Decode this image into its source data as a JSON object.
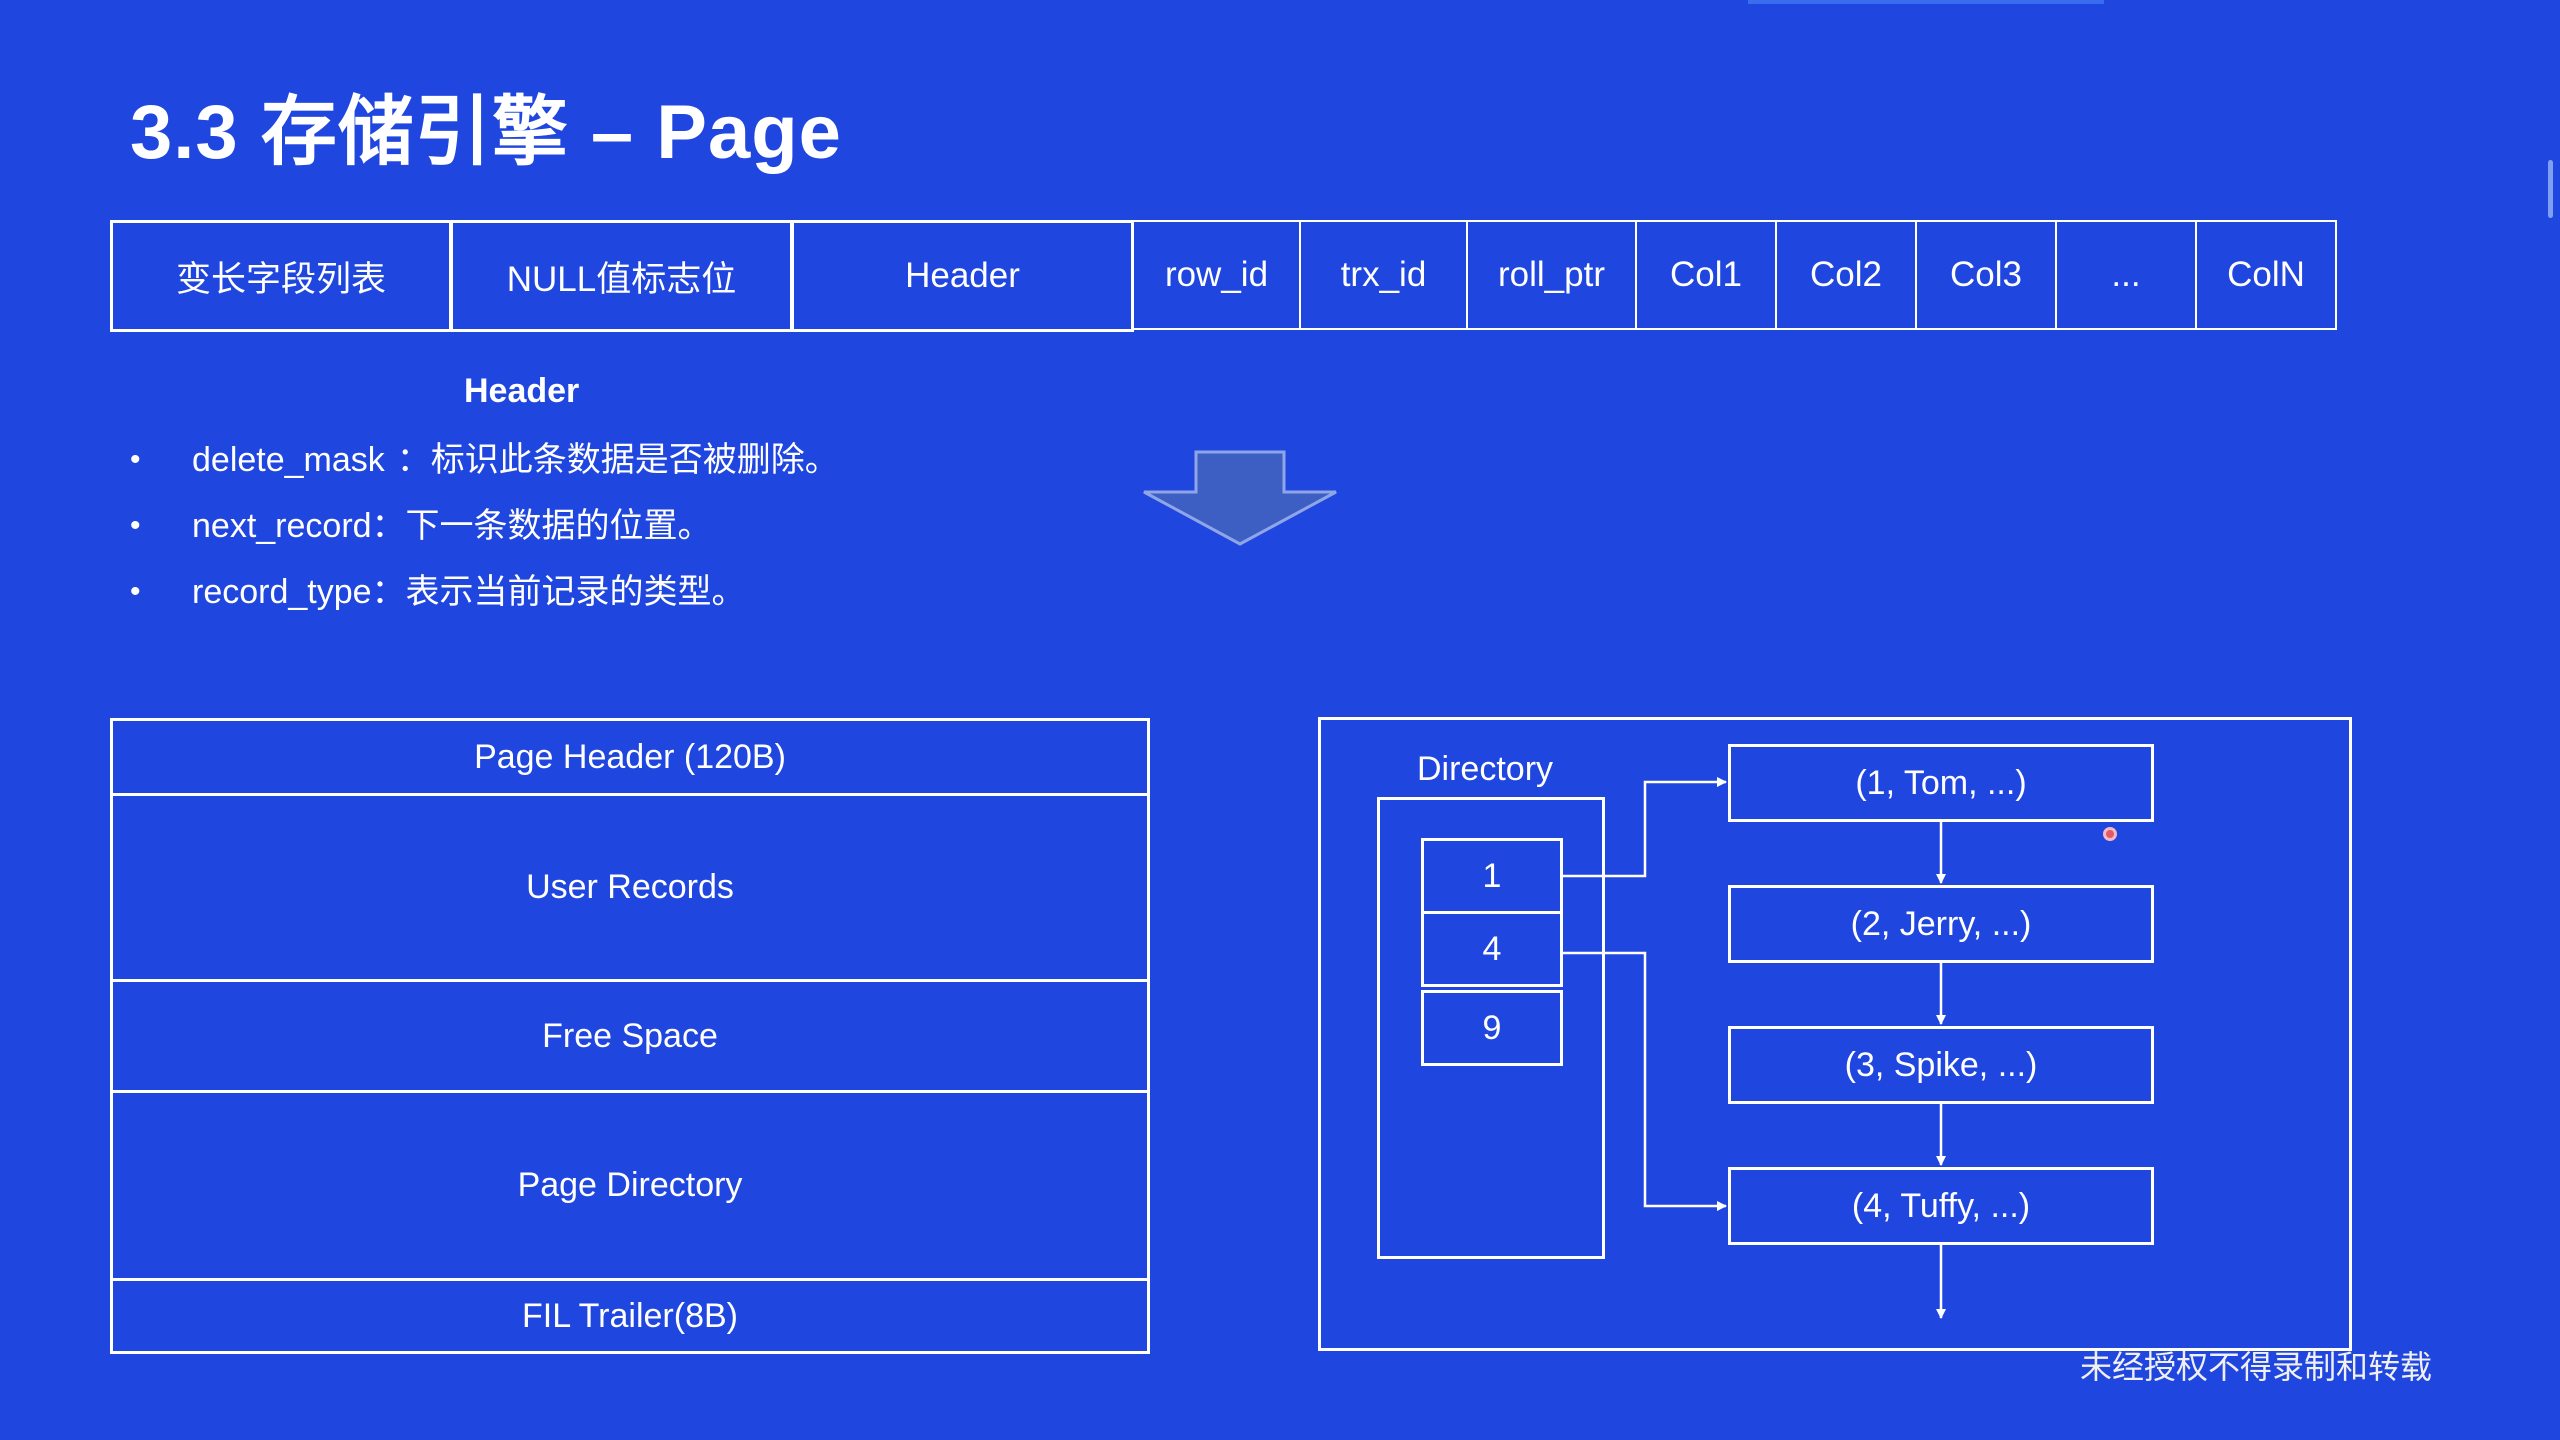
{
  "title": "3.3 存储引擎 – Page",
  "row_format": {
    "cells": [
      {
        "label": "变长字段列表"
      },
      {
        "label": "NULL值标志位"
      },
      {
        "label": "Header"
      },
      {
        "label": "row_id"
      },
      {
        "label": "trx_id"
      },
      {
        "label": "roll_ptr"
      },
      {
        "label": "Col1"
      },
      {
        "label": "Col2"
      },
      {
        "label": "Col3"
      },
      {
        "label": "..."
      },
      {
        "label": "ColN"
      }
    ]
  },
  "header_notes": {
    "title": "Header",
    "bullets": [
      {
        "key": "delete_mask",
        "sep": "：",
        "desc": "标识此条数据是否被删除。"
      },
      {
        "key": "next_record",
        "sep": "：",
        "desc": "下一条数据的位置。"
      },
      {
        "key": "record_type",
        "sep": "：",
        "desc": "表示当前记录的类型。"
      }
    ]
  },
  "page_layout": {
    "sections": [
      {
        "label": "Page Header (120B)"
      },
      {
        "label": "User Records"
      },
      {
        "label": "Free Space"
      },
      {
        "label": "Page Directory"
      },
      {
        "label": "FIL Trailer(8B)"
      }
    ]
  },
  "directory": {
    "label": "Directory",
    "slots": [
      "1",
      "4",
      "9"
    ]
  },
  "records": [
    "(1, Tom, ...)",
    "(2, Jerry, ...)",
    "(3, Spike, ...)",
    "(4, Tuffy, ...)"
  ],
  "watermark": "未经授权不得录制和转载",
  "colors": {
    "background": "#2046e0",
    "line": "#ffffff",
    "arrow_fill": "#3d5fc4"
  }
}
